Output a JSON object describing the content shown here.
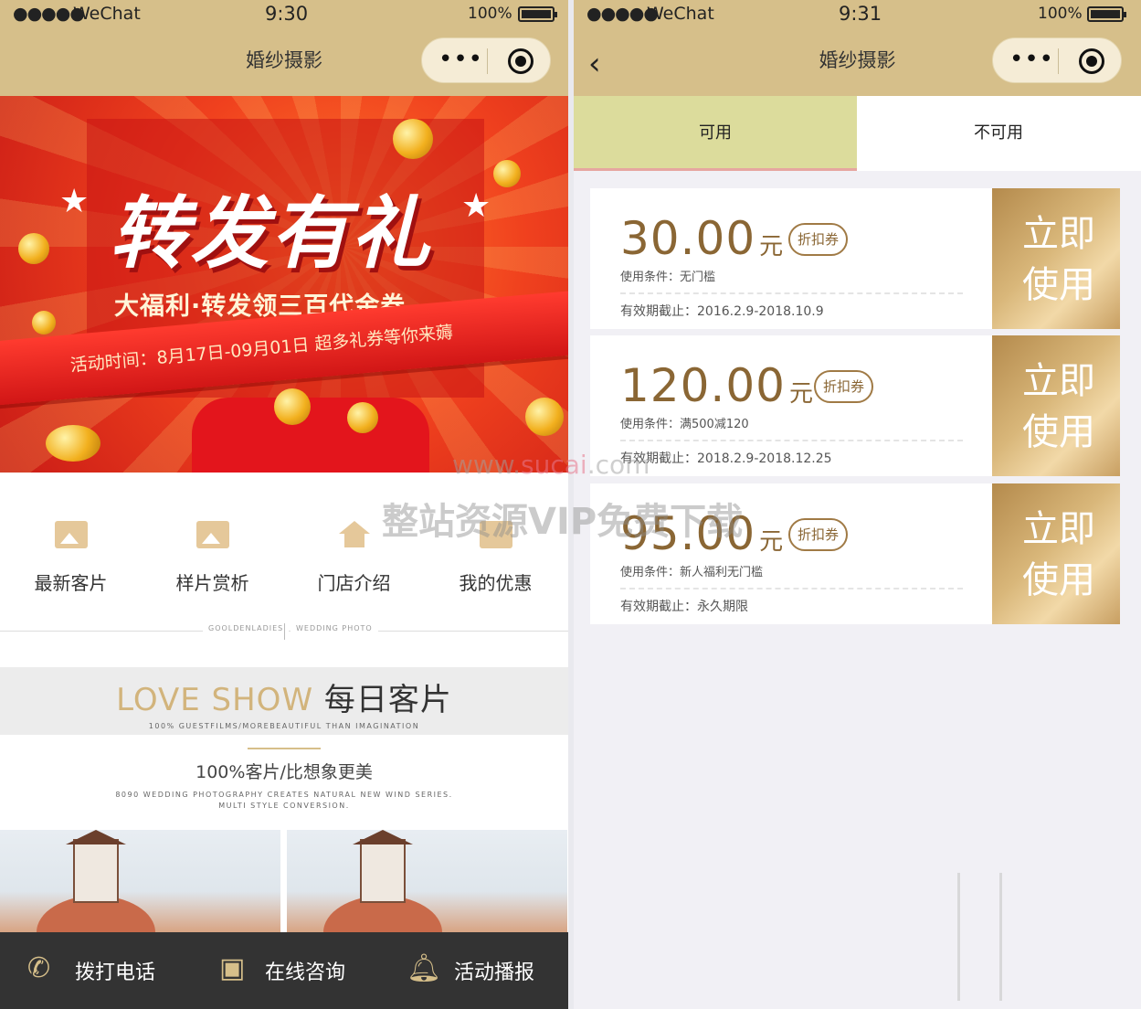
{
  "left": {
    "status": {
      "dots": "●●●●●",
      "carrier": "WeChat",
      "wifi": "wifi-icon",
      "time": "9:30",
      "battery": "100%"
    },
    "nav": {
      "title": "婚纱摄影",
      "more": "•••"
    },
    "banner": {
      "title": "转发有礼",
      "subtitle": "大福利·转发领三百代金券",
      "ribbon": "活动时间：8月17日-09月01日 超多礼券等你来薅"
    },
    "menu": [
      {
        "label": "最新客片",
        "icon": "image-icon"
      },
      {
        "label": "样片赏析",
        "icon": "photo-icon"
      },
      {
        "label": "门店介绍",
        "icon": "house-icon"
      },
      {
        "label": "我的优惠",
        "icon": "coupon-icon"
      }
    ],
    "divider": {
      "left": "GOOLDENLADIES",
      "right": "WEDDING PHOTO"
    },
    "love_show": {
      "title_en": "LOVE SHOW",
      "title_cn": "每日客片",
      "subtitle": "100% GUESTFILMS/MOREBEAUTIFUL THAN IMAGINATION"
    },
    "tagline": {
      "main": "100%客片/比想象更美",
      "sub1": "8090 WEDDING PHOTOGRAPHY CREATES NATURAL NEW WIND SERIES.",
      "sub2": "MULTI STYLE CONVERSION."
    },
    "tabbar": [
      {
        "label": "拨打电话",
        "icon": "phone-icon"
      },
      {
        "label": "在线咨询",
        "icon": "chat-image-icon"
      },
      {
        "label": "活动播报",
        "icon": "bell-icon"
      }
    ]
  },
  "right": {
    "status": {
      "dots": "●●●●●",
      "carrier": "WeChat",
      "wifi": "wifi-icon",
      "time": "9:31",
      "battery": "100%"
    },
    "nav": {
      "title": "婚纱摄影",
      "more": "•••",
      "back": "‹"
    },
    "tabs": {
      "available": "可用",
      "unavailable": "不可用"
    },
    "coupons": [
      {
        "amount": "30.00",
        "unit": "元",
        "badge": "折扣券",
        "condition": "使用条件：无门槛",
        "validity": "有效期截止：2016.2.9-2018.10.9",
        "action": "立即使用"
      },
      {
        "amount": "120.00",
        "unit": "元",
        "badge": "折扣券",
        "condition": "使用条件：满500减120",
        "validity": "有效期截止：2018.2.9-2018.12.25",
        "action": "立即使用"
      },
      {
        "amount": "95.00",
        "unit": "元",
        "badge": "折扣券",
        "condition": "使用条件：新人福利无门槛",
        "validity": "有效期截止：永久期限",
        "action": "立即使用"
      }
    ]
  },
  "watermark": {
    "site_a": "www.",
    "site_b": "sucai",
    "site_c": ".com",
    "text": "整站资源VIP免费下载"
  },
  "colors": {
    "header": "#d6bf8a",
    "gold": "#8a6634",
    "tabbar": "#333333",
    "tab_active": "#dcdc9c"
  }
}
